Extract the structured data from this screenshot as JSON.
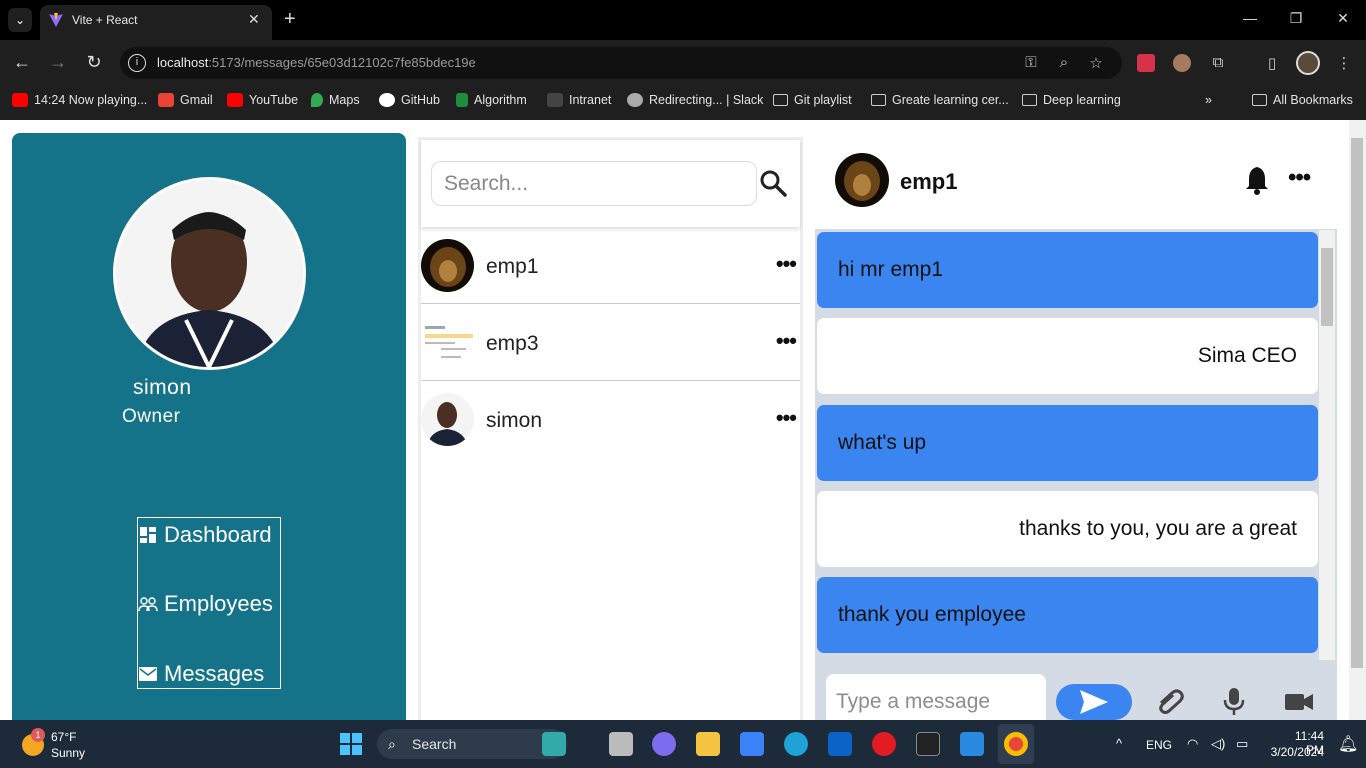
{
  "browser": {
    "tab_title": "Vite + React",
    "url_host": "localhost",
    "url_path": ":5173/messages/65e03d12102c7fe85bdec19e",
    "bookmarks": [
      {
        "label": "14:24 Now playing...",
        "color": "#ff0000"
      },
      {
        "label": "Gmail",
        "color": "#ea4335"
      },
      {
        "label": "YouTube",
        "color": "#ff0000"
      },
      {
        "label": "Maps",
        "color": "#34a853"
      },
      {
        "label": "GitHub",
        "color": "#ffffff"
      },
      {
        "label": "Algorithm",
        "color": "#1e8e3e"
      },
      {
        "label": "Intranet",
        "color": "#555555"
      },
      {
        "label": "Redirecting... | Slack",
        "color": "#aaaaaa"
      },
      {
        "label": "Git playlist",
        "color": "folder"
      },
      {
        "label": "Greate learning cer...",
        "color": "folder"
      },
      {
        "label": "Deep learning",
        "color": "folder"
      }
    ],
    "all_bookmarks": "All Bookmarks"
  },
  "sidebar": {
    "name": "simon",
    "role": "Owner",
    "nav": [
      {
        "label": "Dashboard",
        "icon": "dashboard-icon"
      },
      {
        "label": "Employees",
        "icon": "people-icon"
      },
      {
        "label": "Messages",
        "icon": "mail-icon"
      }
    ],
    "bg_color": "#147389"
  },
  "contacts": {
    "search_placeholder": "Search...",
    "list": [
      {
        "name": "emp1",
        "more": "•••"
      },
      {
        "name": "emp3",
        "more": "•••"
      },
      {
        "name": "simon",
        "more": "•••"
      }
    ]
  },
  "chat": {
    "name": "emp1",
    "more": "•••",
    "messages": [
      {
        "text": "hi mr emp1",
        "type": "sent"
      },
      {
        "text": "Sima CEO",
        "type": "received"
      },
      {
        "text": "what's up",
        "type": "sent"
      },
      {
        "text": "thanks to you, you are a great",
        "type": "received"
      },
      {
        "text": "thank you employee",
        "type": "sent"
      }
    ],
    "input_placeholder": "Type a message",
    "accent_color": "#3a85f0"
  },
  "taskbar": {
    "weather_temp": "67°F",
    "weather_cond": "Sunny",
    "weather_badge": "1",
    "search_label": "Search",
    "lang": "ENG",
    "time": "11:44 PM",
    "date": "3/20/2024"
  }
}
